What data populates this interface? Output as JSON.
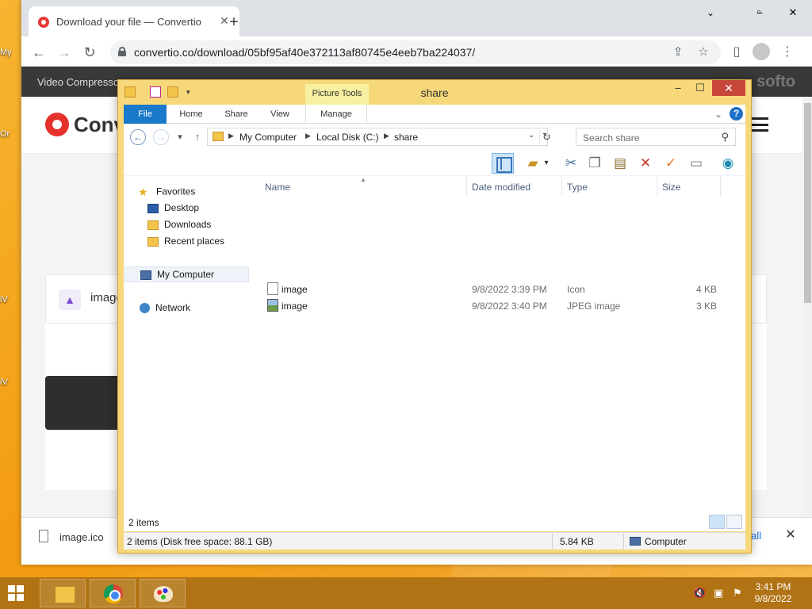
{
  "desktop": {
    "icon_labels": [
      "My",
      "Or",
      "iV",
      "iV"
    ]
  },
  "browser": {
    "tab_title": "Download your file — Convertio",
    "url": "convertio.co/download/05bf95af40e372113af80745e4eeb7ba224037/"
  },
  "site": {
    "nav_text": "Video Compressor",
    "nav_logo": "softo",
    "logo_text": "Conv",
    "file_card_name": "image",
    "download_file": "image.ico",
    "download_show_all": "all"
  },
  "explorer": {
    "title": "share",
    "picture_tools": "Picture Tools",
    "ribbon_tabs": [
      "File",
      "Home",
      "Share",
      "View",
      "Manage"
    ],
    "breadcrumb": [
      "My Computer",
      "Local Disk (C:)",
      "share"
    ],
    "search_placeholder": "Search share",
    "nav_pane": {
      "favorites": "Favorites",
      "desktop": "Desktop",
      "downloads": "Downloads",
      "recent": "Recent places",
      "computer": "My Computer",
      "network": "Network"
    },
    "columns": [
      "Name",
      "Date modified",
      "Type",
      "Size"
    ],
    "files": [
      {
        "name": "image",
        "date": "9/8/2022 3:39 PM",
        "type": "Icon",
        "size": "4 KB"
      },
      {
        "name": "image",
        "date": "9/8/2022 3:40 PM",
        "type": "JPEG image",
        "size": "3 KB"
      }
    ],
    "item_count": "2 items",
    "bottom_status": "2 items (Disk free space: 88.1 GB)",
    "bottom_size": "5.84 KB",
    "bottom_location": "Computer"
  },
  "taskbar": {
    "time": "3:41 PM",
    "date": "9/8/2022"
  }
}
